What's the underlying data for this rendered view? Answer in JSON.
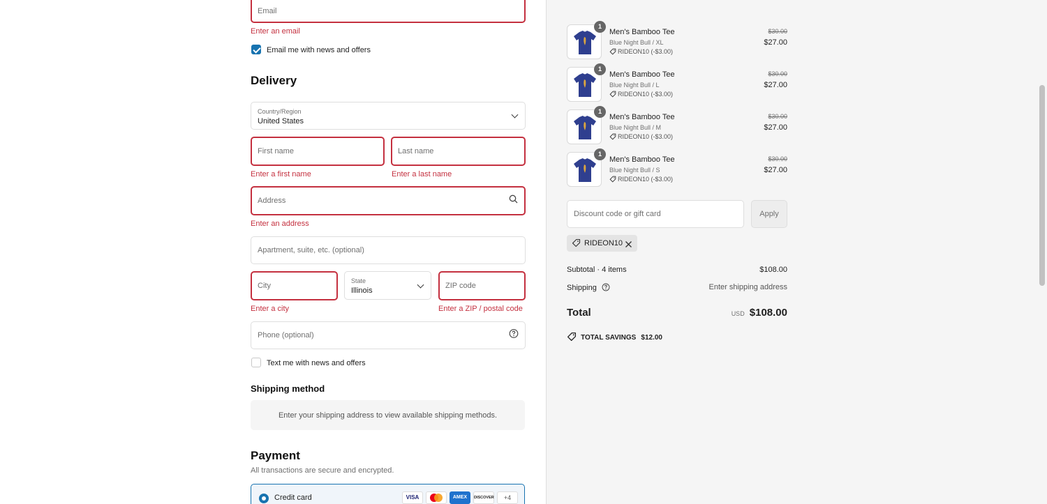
{
  "contact": {
    "email_placeholder": "Email",
    "email_error": "Enter an email",
    "newsletter_label": "Email me with news and offers",
    "newsletter_checked": true
  },
  "delivery": {
    "heading": "Delivery",
    "country_label": "Country/Region",
    "country_value": "United States",
    "first_name_placeholder": "First name",
    "first_name_error": "Enter a first name",
    "last_name_placeholder": "Last name",
    "last_name_error": "Enter a last name",
    "address_placeholder": "Address",
    "address_error": "Enter an address",
    "apartment_placeholder": "Apartment, suite, etc. (optional)",
    "city_placeholder": "City",
    "city_error": "Enter a city",
    "state_label": "State",
    "state_value": "Illinois",
    "zip_placeholder": "ZIP code",
    "zip_error": "Enter a ZIP / postal code",
    "phone_placeholder": "Phone (optional)",
    "sms_label": "Text me with news and offers",
    "sms_checked": false
  },
  "shipping_method": {
    "heading": "Shipping method",
    "message": "Enter your shipping address to view available shipping methods."
  },
  "payment": {
    "heading": "Payment",
    "subtext": "All transactions are secure and encrypted.",
    "option_label": "Credit card",
    "cards": [
      "VISA",
      "MC",
      "AMEX",
      "DISCOVER"
    ],
    "more_cards": "+4"
  },
  "order": {
    "items": [
      {
        "qty": "1",
        "name": "Men's Bamboo Tee",
        "variant": "Blue Night Bull / XL",
        "discount": "RIDEON10 (-$3.00)",
        "original_price": "$30.00",
        "price": "$27.00"
      },
      {
        "qty": "1",
        "name": "Men's Bamboo Tee",
        "variant": "Blue Night Bull / L",
        "discount": "RIDEON10 (-$3.00)",
        "original_price": "$30.00",
        "price": "$27.00"
      },
      {
        "qty": "1",
        "name": "Men's Bamboo Tee",
        "variant": "Blue Night Bull / M",
        "discount": "RIDEON10 (-$3.00)",
        "original_price": "$30.00",
        "price": "$27.00"
      },
      {
        "qty": "1",
        "name": "Men's Bamboo Tee",
        "variant": "Blue Night Bull / S",
        "discount": "RIDEON10 (-$3.00)",
        "original_price": "$30.00",
        "price": "$27.00"
      }
    ],
    "discount_placeholder": "Discount code or gift card",
    "apply_label": "Apply",
    "applied_code": "RIDEON10",
    "subtotal_label": "Subtotal · 4 items",
    "subtotal_value": "$108.00",
    "shipping_label": "Shipping",
    "shipping_value": "Enter shipping address",
    "total_label": "Total",
    "currency": "USD",
    "total_value": "$108.00",
    "savings_label": "TOTAL SAVINGS",
    "savings_value": "$12.00"
  },
  "colors": {
    "accent": "#1773b0",
    "error": "#c4303f",
    "shirt": "#2f3f8f"
  }
}
